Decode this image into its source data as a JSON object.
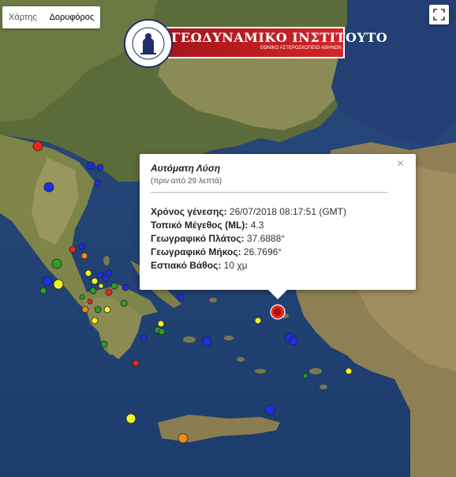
{
  "map_type": {
    "map_label": "Χάρτης",
    "satellite_label": "Δορυφόρος"
  },
  "logo": {
    "title": "ΓΕΩΔΥΝΑΜΙΚΟ ΙΝΣΤΙΤΟΥΤΟ",
    "subtitle": "ΕΘΝΙΚΟ ΑΣΤΕΡΟΣΚΟΠΕΙΟ ΑΘΗΝΩΝ",
    "seal_text": "ΕΘΝΙΚΟΝ ΑΣΤΕΡΟΣΚΟΠΕΙΟΝ ΑΘΗΝΩΝ · NATIONAL OBSERVATORY OF ATHENS"
  },
  "info": {
    "title": "Αυτόματη Λύση",
    "ago": "(πριν από 29 λεπτά)",
    "rows": [
      {
        "label": "Χρόνος γένεσης:",
        "value": "26/07/2018  08:17:51 (GMT)"
      },
      {
        "label": "Τοπικό Μέγεθος (ML):",
        "value": "4.3"
      },
      {
        "label": "Γεωγραφικό Πλάτος:",
        "value": "37.6888°"
      },
      {
        "label": "Γεωγραφικό Μήκος:",
        "value": "26.7696°"
      },
      {
        "label": "Εστιακό Βάθος:",
        "value": "10 χμ"
      }
    ]
  },
  "colors": {
    "red": "#e8281e",
    "orange": "#f08a1c",
    "yellow": "#f2f22a",
    "green": "#2f9c2b",
    "blue": "#1d2fe0"
  },
  "icons": {
    "fullscreen": "fullscreen-icon",
    "close": "close-icon"
  }
}
